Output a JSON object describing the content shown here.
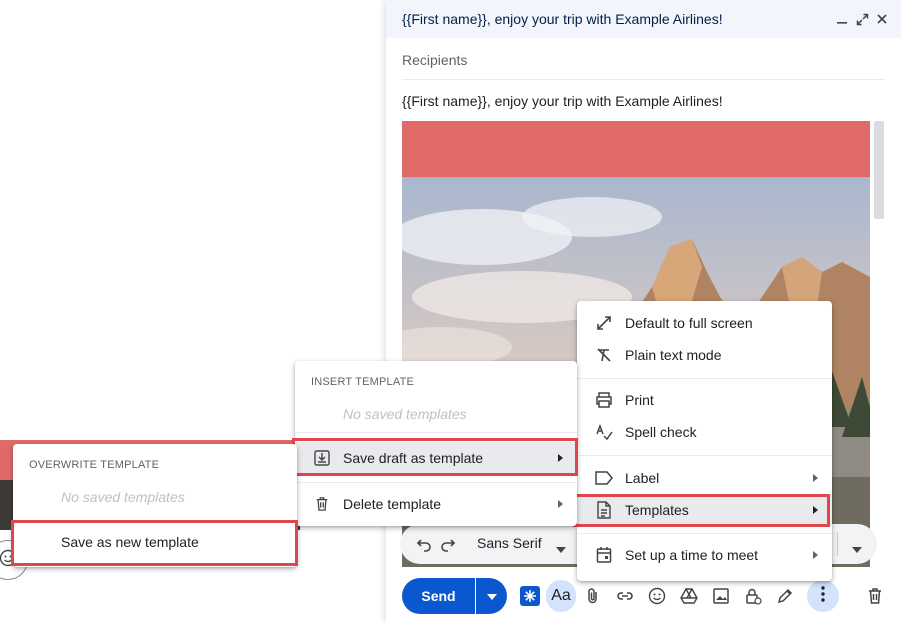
{
  "compose": {
    "title": "{{First name}}, enjoy your trip with Example Airlines!",
    "recipients_placeholder": "Recipients",
    "subject": "{{First name}}, enjoy your trip with Example Airlines!"
  },
  "format_bar": {
    "font": "Sans Serif"
  },
  "toolbar": {
    "send_label": "Send",
    "formatting_label": "Aa"
  },
  "more_menu": {
    "items": [
      {
        "label": "Default to full screen",
        "icon": "expand-icon"
      },
      {
        "label": "Plain text mode",
        "icon": "clear-format-icon"
      },
      {
        "label": "Print",
        "icon": "print-icon"
      },
      {
        "label": "Spell check",
        "icon": "spellcheck-icon"
      },
      {
        "label": "Label",
        "icon": "label-icon"
      },
      {
        "label": "Templates",
        "icon": "template-icon"
      },
      {
        "label": "Set up a time to meet",
        "icon": "calendar-icon"
      }
    ]
  },
  "templates_menu": {
    "section": "INSERT TEMPLATE",
    "empty": "No saved templates",
    "save_draft": "Save draft as template",
    "delete": "Delete template"
  },
  "overwrite_menu": {
    "section": "OVERWRITE TEMPLATE",
    "empty": "No saved templates",
    "save_new": "Save as new template"
  },
  "colors": {
    "accent": "#0b57d0",
    "highlight": "#e0474c",
    "banner": "#e06a68"
  }
}
